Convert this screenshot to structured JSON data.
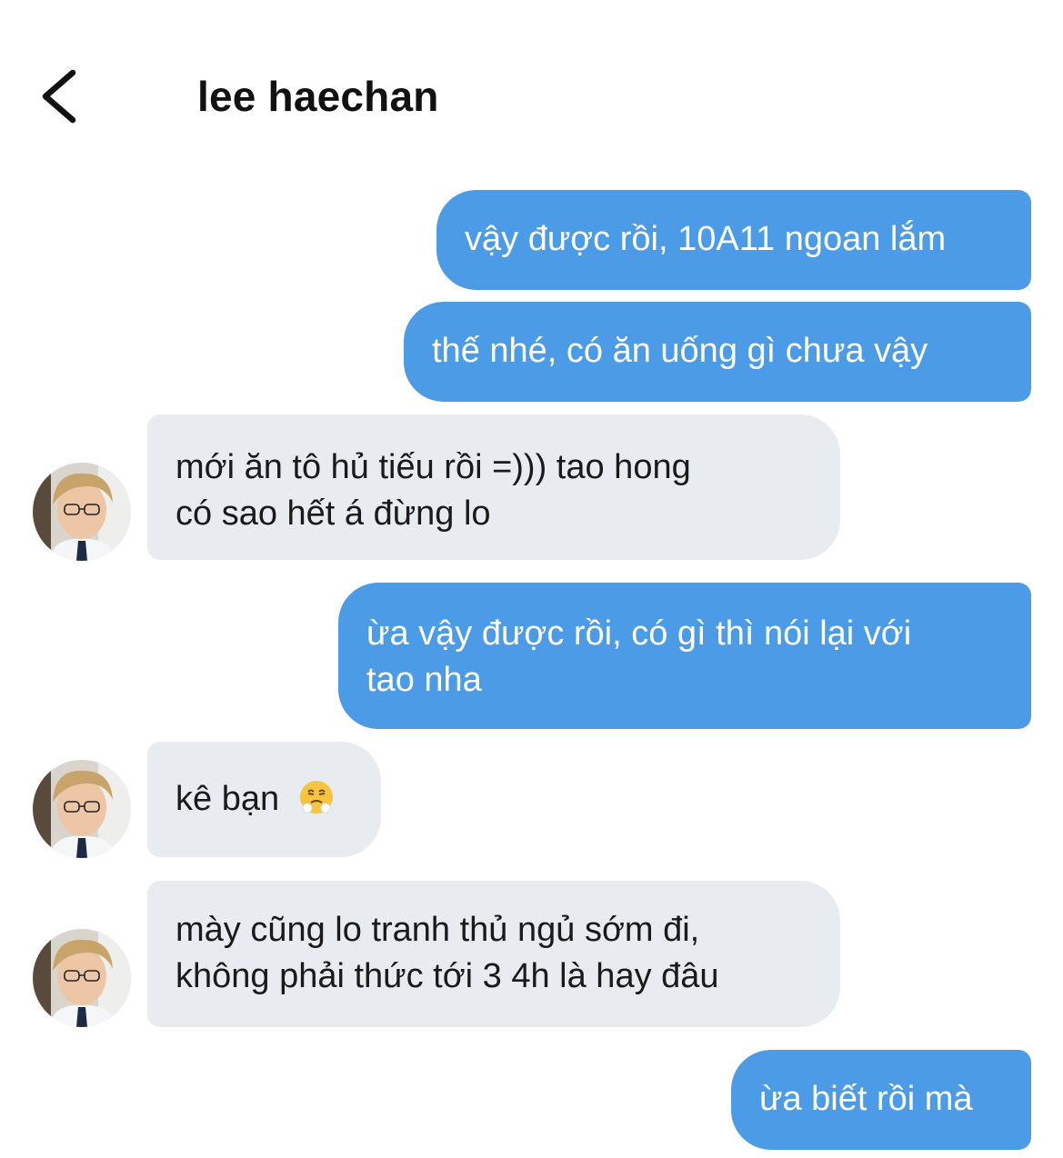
{
  "header": {
    "back_icon": "chevron-left-icon",
    "contact_name": "lee haechan"
  },
  "messages": [
    {
      "sender": "me",
      "lines": [
        "vậy được rồi, 10A11 ngoan lắm"
      ]
    },
    {
      "sender": "me",
      "lines": [
        "thế nhé, có ăn uống gì chưa vậy"
      ]
    },
    {
      "sender": "them",
      "lines": [
        "mới ăn tô hủ tiếu rồi =))) tao hong",
        "có sao hết á đừng lo"
      ]
    },
    {
      "sender": "me",
      "lines": [
        "ừa vậy được rồi, có gì thì nói lại với",
        "tao nha"
      ]
    },
    {
      "sender": "them",
      "lines": [
        "kê bạn"
      ],
      "emoji": "face-with-steam-from-nose-emoji"
    },
    {
      "sender": "them",
      "lines": [
        "mày cũng lo tranh thủ ngủ sớm đi,",
        "không phải thức tới 3 4h là hay đâu"
      ]
    },
    {
      "sender": "me",
      "lines": [
        "ừa biết rồi mà"
      ]
    }
  ],
  "colors": {
    "sent_bubble": "#4c9be6",
    "received_bubble": "#e8ebef",
    "background": "#ffffff"
  }
}
